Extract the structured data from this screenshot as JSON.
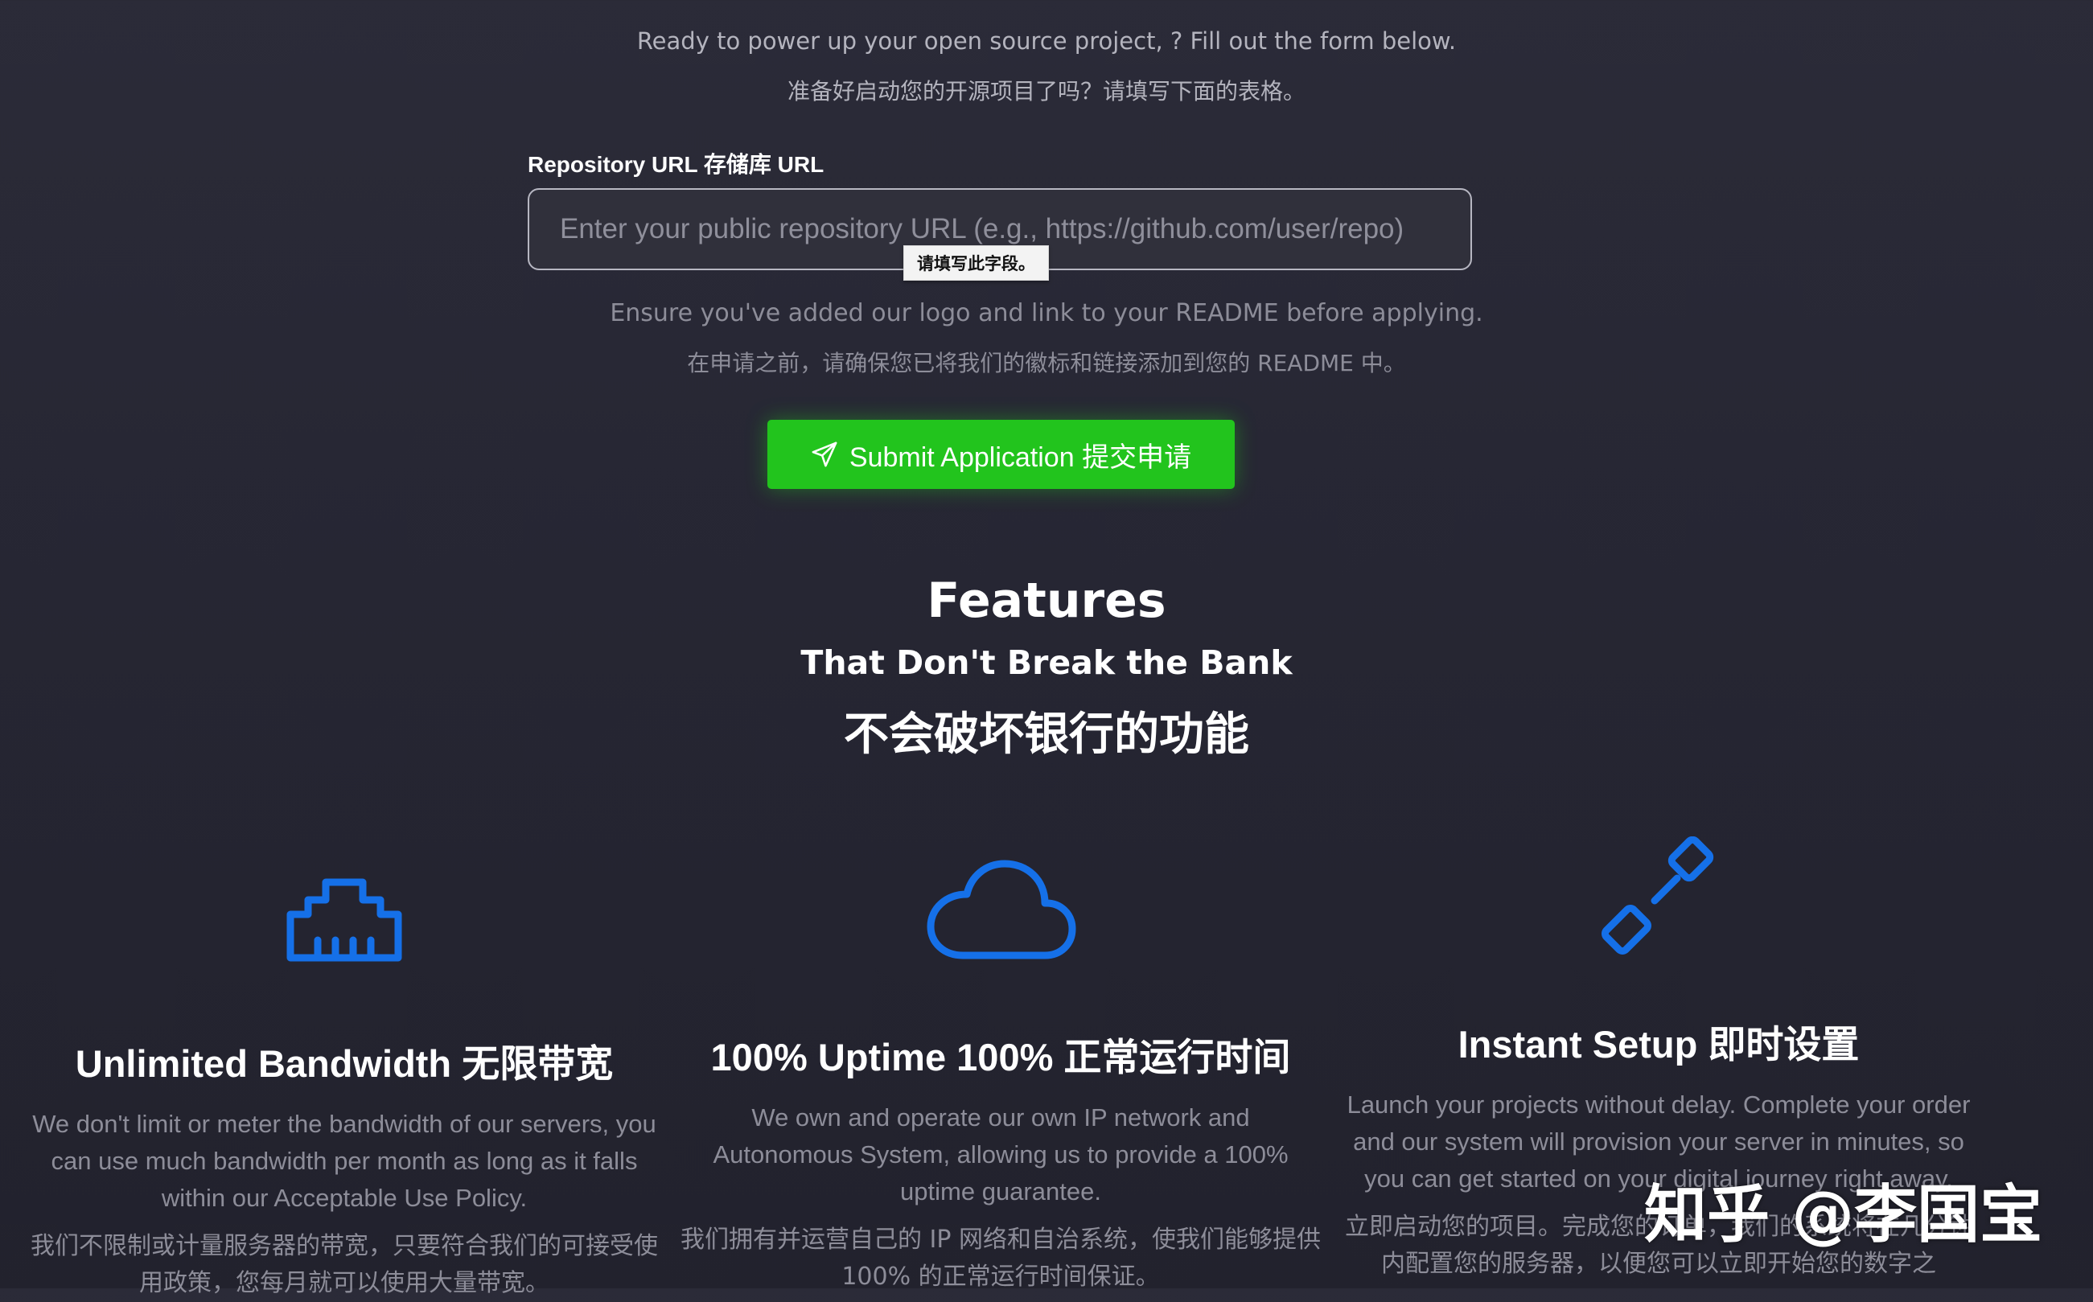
{
  "form": {
    "intro_en": "Ready to power up your open source project, ? Fill out the form below.",
    "intro_zh": "准备好启动您的开源项目了吗？请填写下面的表格。",
    "repo_label": "Repository URL  存储库 URL",
    "repo_placeholder": "Enter your public repository URL (e.g., https://github.com/user/repo)",
    "repo_value": "",
    "validation_tooltip": "请填写此字段。",
    "readme_note_en": "Ensure you've added our logo and link to your README before applying.",
    "readme_note_zh": "在申请之前，请确保您已将我们的徽标和链接添加到您的 README 中。",
    "submit_label": "Submit Application   提交申请",
    "submit_icon": "paper-plane-icon",
    "accent_color": "#22c41d"
  },
  "features": {
    "title": "Features",
    "subtitle": "That Don't Break the Bank",
    "subtitle_zh": "不会破坏银行的功能",
    "items": [
      {
        "icon": "ethernet-port-icon",
        "title": "Unlimited Bandwidth  无限带宽",
        "desc_en": "We don't limit or meter the bandwidth of our servers, you can use much bandwidth per month as long as it falls within our Acceptable Use Policy.",
        "desc_zh": "我们不限制或计量服务器的带宽，只要符合我们的可接受使用政策，您每月就可以使用大量带宽。"
      },
      {
        "icon": "cloud-icon",
        "title": "100% Uptime  100% 正常运行时间",
        "desc_en": "We own and operate our own IP network and Autonomous System, allowing us to provide a 100% uptime guarantee.",
        "desc_zh": "我们拥有并运营自己的 IP 网络和自治系统，使我们能够提供 100% 的正常运行时间保证。"
      },
      {
        "icon": "connector-plug-icon",
        "title": "Instant Setup  即时设置",
        "desc_en": "Launch your projects without delay. Complete your order and our system will provision your server in minutes, so you can get started on your digital journey right away.",
        "desc_zh": "立即启动您的项目。完成您的订单，我们的系统将在几分钟内配置您的服务器，以便您可以立即开始您的数字之"
      }
    ],
    "icon_color": "#1570e8"
  },
  "watermark": "知乎 @李国宝"
}
